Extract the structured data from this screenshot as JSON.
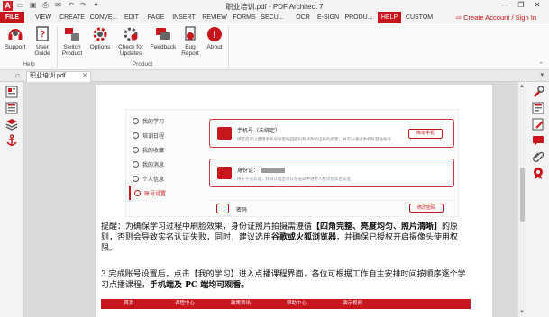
{
  "app": {
    "logo": "A",
    "title": "职业培训.pdf   -   PDF Architect 7",
    "window_controls": [
      "—",
      "❐",
      "✕"
    ]
  },
  "menu": {
    "tabs": [
      "FILE",
      "VIEW",
      "CREATE",
      "CONVE...",
      "EDIT",
      "PAGE",
      "INSERT",
      "REVIEW",
      "FORMS",
      "SECU...",
      "OCR",
      "E-SIGN",
      "PRODU...",
      "HELP",
      "CUSTOM"
    ],
    "active": "HELP",
    "account": "Create Account / Sign In"
  },
  "ribbon": {
    "help_group": "Help",
    "product_group": "Product",
    "buttons": {
      "support": "Support",
      "user_guide_1": "User",
      "user_guide_2": "Guide",
      "switch_1": "Switch",
      "switch_2": "Product",
      "options": "Options",
      "check_1": "Check for",
      "check_2": "Updates",
      "feedback": "Feedback",
      "bug_1": "Bug",
      "bug_2": "Report",
      "about": "About"
    }
  },
  "doc_tabs": {
    "file_name": "职业培训.pdf",
    "close": "✕"
  },
  "page_content": {
    "side_menu": [
      "我的学习",
      "培训日程",
      "我的收藏",
      "我的消息",
      "个人信息",
      "账号设置"
    ],
    "selected_side": "账号设置",
    "card_phone": {
      "title": "手机号（未绑定）",
      "sub": "绑定后可以使用手机号加密找回密码和修改验证码的步骤，并可以通过手机号登陆账号",
      "button": "绑定手机"
    },
    "card_id": {
      "title": "身份证：",
      "sub": "用于学员认证，获得认证后可以在培训中进行人脸识别实名认证",
      "button": ""
    },
    "card_password": {
      "title": "密码",
      "button": "修改密码"
    },
    "para1": {
      "t1": "提醒：为确保学习过程中刷脸效果，身份证照片拍摄需遵循",
      "b1": "【四角完整、亮度均匀、照片清晰】",
      "t2": "的原则，否则会导致实名认证失败，同时，建议选用",
      "b2": "谷歌或火狐浏览器",
      "t3": "，并确保已授权开启摄像头使用权限。"
    },
    "para2": {
      "t1": "3.完成账号设置后，点击【我的学习】进入点播课程界面，各位可根据工作自主安排时间按顺序逐个学习点播课程，",
      "b1": "手机端及 PC 端均可观看。"
    },
    "table_headers": [
      "首页",
      "课程中心",
      "政策资讯",
      "帮助中心",
      "演示视频"
    ]
  },
  "colors": {
    "accent": "#c8161d",
    "ribbon_bg": "#fafafa"
  }
}
